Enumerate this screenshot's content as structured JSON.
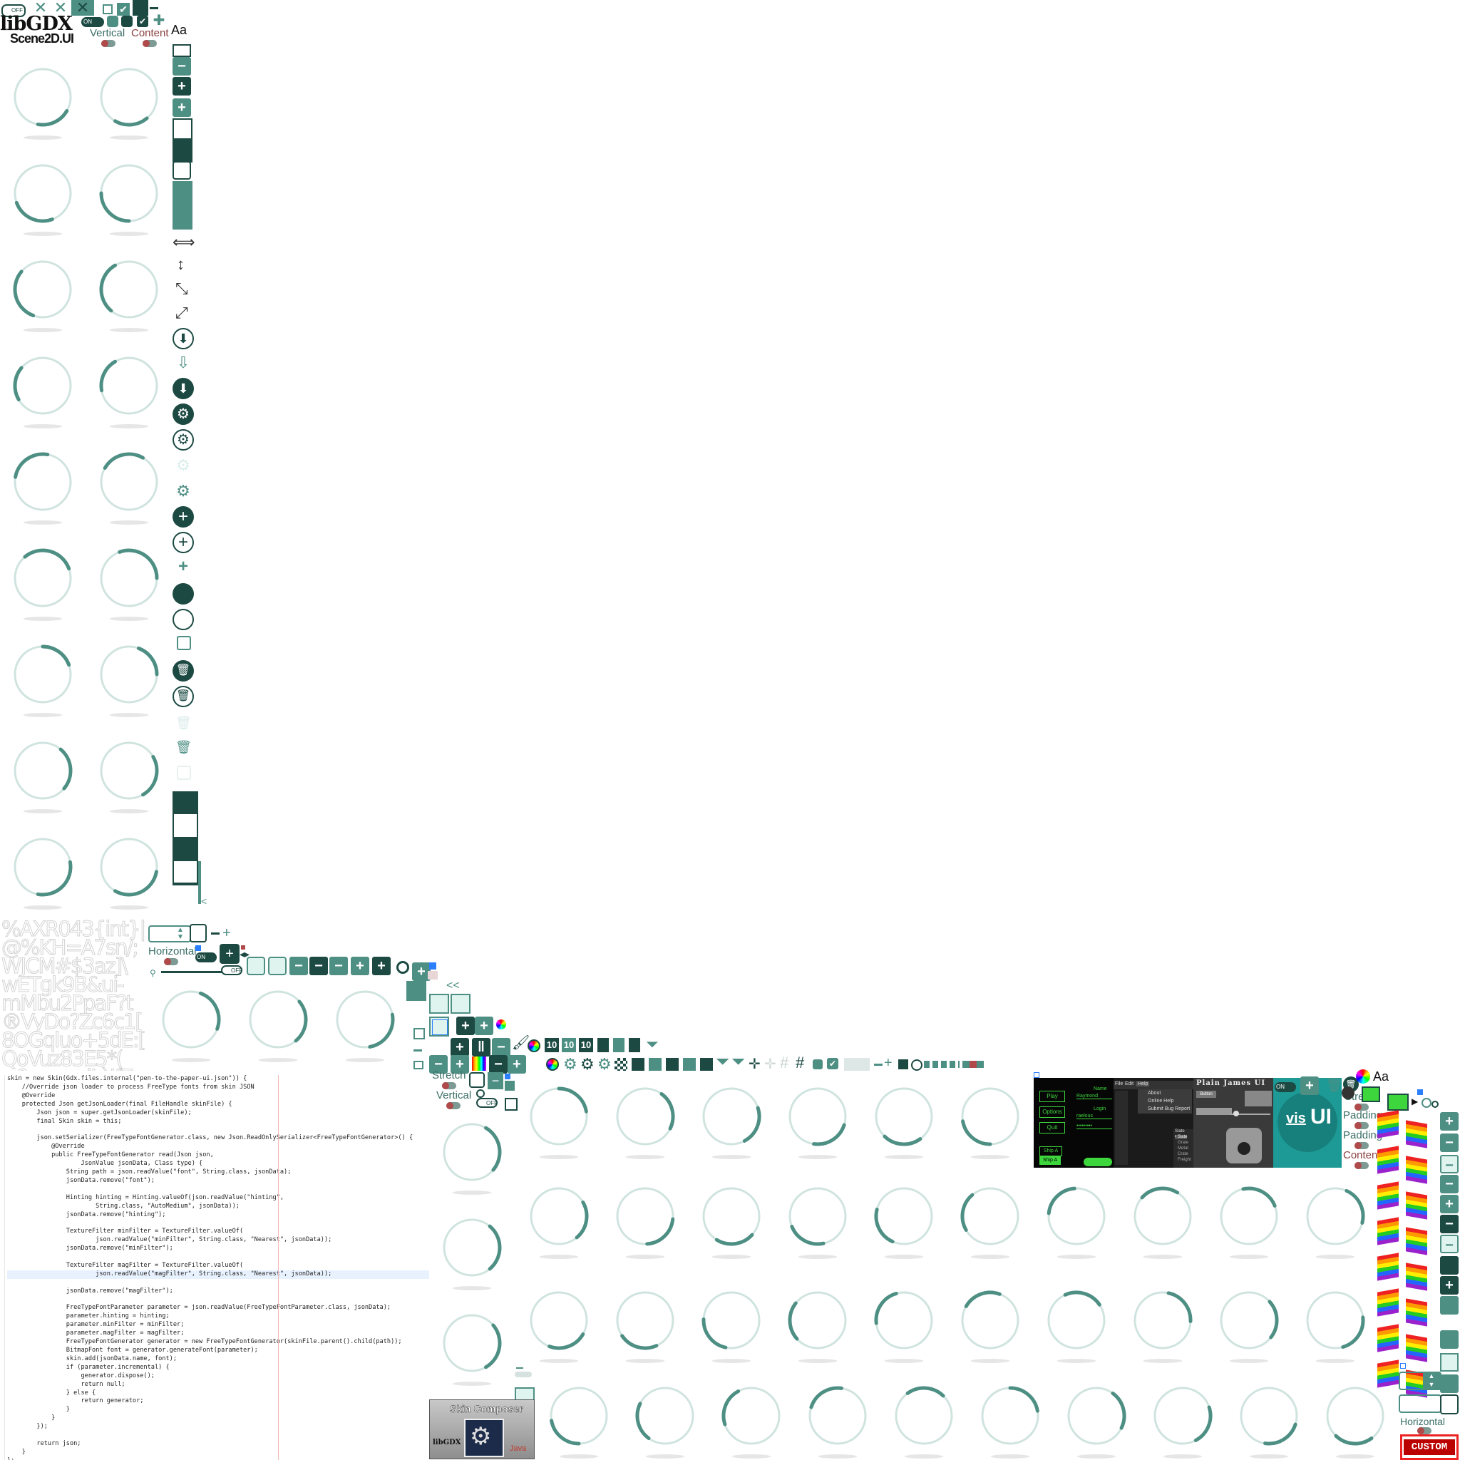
{
  "logo": {
    "brand": "libGDX",
    "product": "Scene2D.UI"
  },
  "toggles": {
    "off_label": "OFF",
    "on_label": "ON"
  },
  "labels": {
    "vertical_top": "Vertical",
    "content_top": "Content",
    "font_sample": "Aa",
    "horizontal_left": "Horizontal",
    "stretch_mid": "Stretch",
    "vertical_mid": "Vertical",
    "stretch_right": "Stretch",
    "padding_right_1": "Padding",
    "padding_right_2": "Padding",
    "content_right": "Content",
    "horizontal_right": "Horizontal",
    "font_sample_right": "Aa",
    "custom": "CUSTOM"
  },
  "number_icons": [
    "10",
    "10",
    "10"
  ],
  "glyph_sheet": "%AXR043{int}|\n@%KH=A7sn/;\nWJCM#$3az]\\\nwETgk9B&ui-\nmMbu2PpaF?t\n®VyDo?Zc6c1[\n8OGqluo+5dE:[\nQoVuz83E5*(\n~?xoye=iL`JfT",
  "code_lines": [
    {
      "t": "skin = new Skin(Gdx.files.internal(\"pen-to-the-paper-ui.json\")) {"
    },
    {
      "t": "    //Override json loader to process FreeType fonts from skin JSON"
    },
    {
      "t": "    @Override"
    },
    {
      "t": "    protected Json getJsonLoader(final FileHandle skinFile) {"
    },
    {
      "t": "        Json json = super.getJsonLoader(skinFile);"
    },
    {
      "t": "        final Skin skin = this;"
    },
    {
      "t": ""
    },
    {
      "t": "        json.setSerializer(FreeTypeFontGenerator.class, new Json.ReadOnlySerializer<FreeTypeFontGenerator>() {"
    },
    {
      "t": "            @Override"
    },
    {
      "t": "            public FreeTypeFontGenerator read(Json json,"
    },
    {
      "t": "                    JsonValue jsonData, Class type) {"
    },
    {
      "t": "                String path = json.readValue(\"font\", String.class, jsonData);"
    },
    {
      "t": "                jsonData.remove(\"font\");"
    },
    {
      "t": ""
    },
    {
      "t": "                Hinting hinting = Hinting.valueOf(json.readValue(\"hinting\","
    },
    {
      "t": "                        String.class, \"AutoMedium\", jsonData));"
    },
    {
      "t": "                jsonData.remove(\"hinting\");"
    },
    {
      "t": ""
    },
    {
      "t": "                TextureFilter minFilter = TextureFilter.valueOf("
    },
    {
      "t": "                        json.readValue(\"minFilter\", String.class, \"Nearest\", jsonData));"
    },
    {
      "t": "                jsonData.remove(\"minFilter\");"
    },
    {
      "t": ""
    },
    {
      "t": "                TextureFilter magFilter = TextureFilter.valueOf("
    },
    {
      "t": "                        json.readValue(\"magFilter\", String.class, \"Nearest\", jsonData));"
    },
    {
      "t": "                jsonData.remove(\"magFilter\");"
    },
    {
      "t": ""
    },
    {
      "t": "                FreeTypeFontParameter parameter = json.readValue(FreeTypeFontParameter.class, jsonData);"
    },
    {
      "t": "                parameter.hinting = hinting;"
    },
    {
      "t": "                parameter.minFilter = minFilter;"
    },
    {
      "t": "                parameter.magFilter = magFilter;"
    },
    {
      "t": "                FreeTypeFontGenerator generator = new FreeTypeFontGenerator(skinFile.parent().child(path));"
    },
    {
      "t": "                BitmapFont font = generator.generateFont(parameter);"
    },
    {
      "t": "                skin.add(jsonData.name, font);"
    },
    {
      "t": "                if (parameter.incremental) {"
    },
    {
      "t": "                    generator.dispose();"
    },
    {
      "t": "                    return null;"
    },
    {
      "t": "                } else {"
    },
    {
      "t": "                    return generator;"
    },
    {
      "t": "                }"
    },
    {
      "t": "            }"
    },
    {
      "t": "        });"
    },
    {
      "t": ""
    },
    {
      "t": "        return json;"
    },
    {
      "t": "    }"
    },
    {
      "t": "};"
    }
  ],
  "preview_green": {
    "buttons": [
      "Play",
      "Options",
      "Quit"
    ],
    "name_label": "Name",
    "name_value": "Raymond",
    "login_label": "Login",
    "login_value": "raelous",
    "password_value": "•••••••••",
    "list": [
      "Ship A",
      "Ship A"
    ]
  },
  "preview_menu": {
    "menus": [
      "File",
      "Edit",
      "Help"
    ],
    "items": [
      "About",
      "Online Help",
      "Submit Bug Report"
    ],
    "list": [
      "Slate",
      "• Slate",
      "Grate",
      "Metal",
      "Crate",
      "Freight"
    ]
  },
  "preview_plain": {
    "title": "Plain James UI",
    "button": "Button"
  },
  "preview_vis": {
    "prefix": "vis",
    "suffix": "UI"
  },
  "skin_composer": {
    "title": "Skin Composer",
    "brand": "libGDX",
    "java": "Java"
  },
  "colors": {
    "teal": "#4e8f84",
    "dark": "#1c4a43",
    "light": "#dff3ef",
    "ring": "#cfe3df",
    "arc": "#4e8f84"
  }
}
